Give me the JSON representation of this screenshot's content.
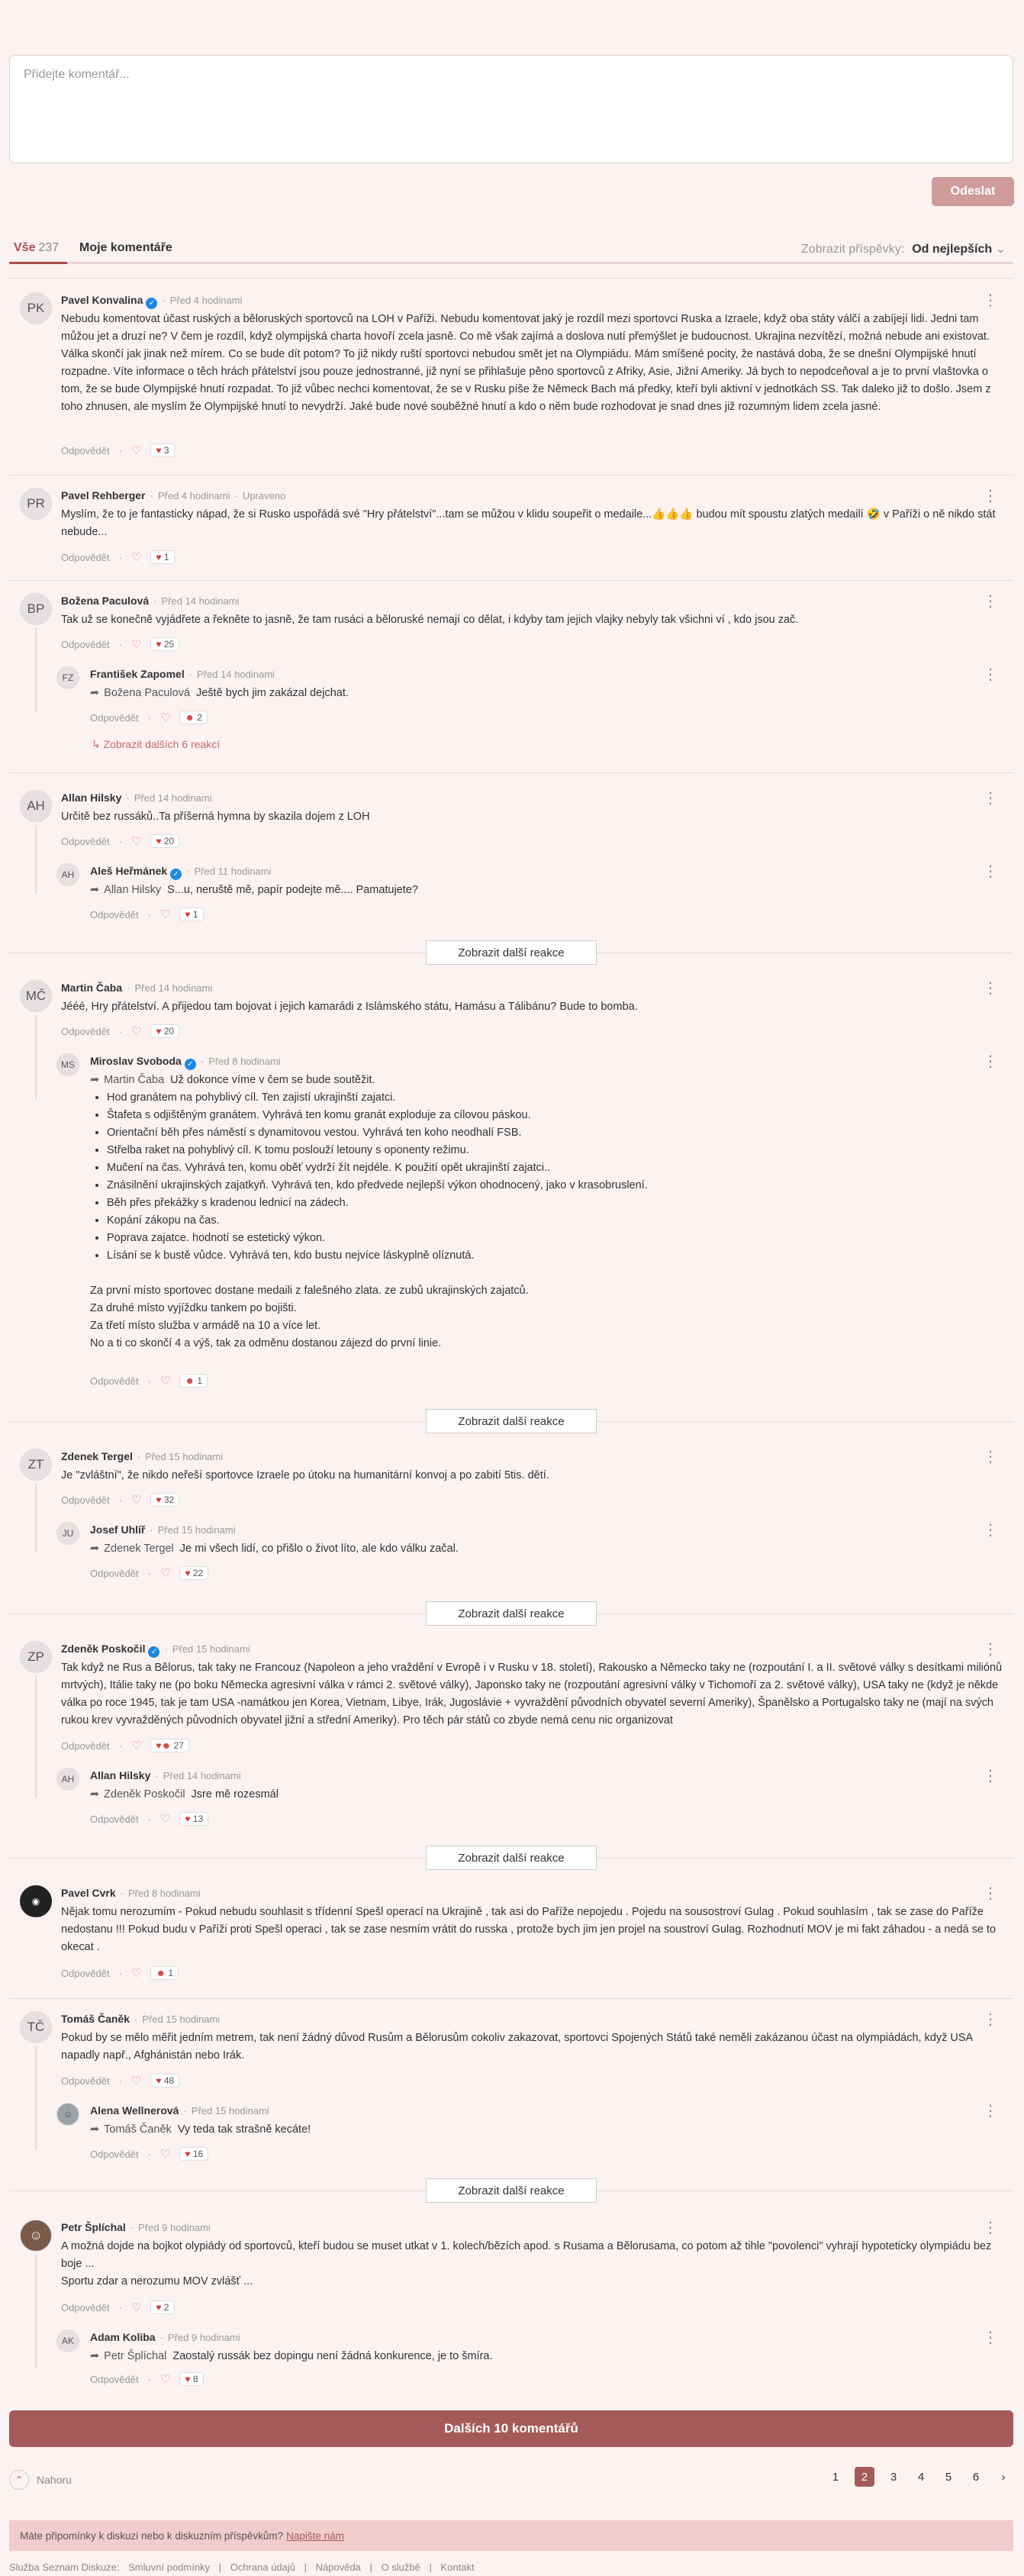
{
  "composer": {
    "placeholder": "Přidejte komentář..."
  },
  "send_label": "Odeslat",
  "tabs": {
    "all_label": "Vše",
    "all_count": "237",
    "mine_label": "Moje komentáře"
  },
  "sort": {
    "label": "Zobrazit příspěvky:",
    "value": "Od nejlepších"
  },
  "reply_label": "Odpovědět",
  "more_reactions": "Zobrazit další reakce",
  "more_comments": "Dalších 10 komentářů",
  "top_label": "Nahoru",
  "pages": [
    "1",
    "2",
    "3",
    "4",
    "5",
    "6"
  ],
  "notice": {
    "text": "Máte připomínky k diskuzi nebo k diskuzním příspěvkům?",
    "link": "Napište nám"
  },
  "footer": [
    "Služba Seznam Diskuze:",
    "Smluvní podmínky",
    "|",
    "Ochrana údajů",
    "|",
    "Nápověda",
    "|",
    "O službě",
    "|",
    "Kontakt"
  ],
  "comments": {
    "c1": {
      "initials": "PK",
      "name": "Pavel Konvalina",
      "time": "Před 4 hodinami",
      "text": "Nebudu komentovat účast ruských a běloruských sportovců na LOH v Paříži. Nebudu komentovat jaký je rozdíl mezi sportovci Ruska a Izraele, když oba státy válčí a zabíjejí lidi. Jedni tam můžou jet a druzí ne? V čem je rozdíl, když olympijská charta hovoří zcela jasně. Co mě však zajímá a doslova nutí přemýšlet je budoucnost. Ukrajina nezvítězí, možná nebude ani existovat. Válka skončí jak jinak než mírem. Co se bude dít potom? To již nikdy ruští sportovci nebudou smět jet na Olympiádu. Mám smíšené pocity, že nastává doba, že se dnešní Olympijské hnutí rozpadne. Víte informace o těch hrách přátelství jsou pouze jednostranné, již nyní se přihlašuje pěno sportovců z Afriky, Asie, Jižní Ameriky. Já bych to nepodceňoval a je to první vlaštovka o tom, že se bude Olympijské hnutí rozpadat. To již vůbec nechci komentovat, že se v Rusku píše že Německ Bach má předky, kteří byli aktivní v jednotkách SS. Tak daleko již to došlo. Jsem z toho zhnusen, ale myslím že Olympijské hnutí to nevydrží. Jaké bude nové souběžné hnutí a kdo o něm bude rozhodovat je snad dnes již rozumným lidem zcela jasné.",
      "reactions": "3"
    },
    "c2": {
      "initials": "PR",
      "name": "Pavel Rehberger",
      "time": "Před 4 hodinami",
      "edited": "Upraveno",
      "text": "Myslím, že to je fantasticky nápad, že si Rusko uspořádá své \"Hry přátelství\"...tam se můžou v klidu soupeřit o medaile...👍👍👍 budou mít spoustu zlatých medailí 🤣 v Paříži o ně nikdo stát nebude...",
      "reactions": "1"
    },
    "c3": {
      "initials": "BP",
      "name": "Božena Paculová",
      "time": "Před 14 hodinami",
      "text": "Tak už se konečně vyjádřete a řekněte to jasně, že tam rusáci a běloruské nemají co dělat, i kdyby tam jejich vlajky nebyly tak všichni ví , kdo jsou zač.",
      "reactions": "25"
    },
    "c3r": {
      "initials": "FZ",
      "name": "František Zapomel",
      "time": "Před 14 hodinami",
      "quote": "Božena Paculová",
      "text": "Ještě bych jim zakázal dejchat.",
      "reactions": "2",
      "more": "Zobrazit dalších 6 reakcí"
    },
    "c4": {
      "initials": "AH",
      "name": "Allan Hilsky",
      "time": "Před 14 hodinami",
      "text": "Určitě bez russáků..Ta příšerná hymna by skazila dojem z LOH",
      "reactions": "20"
    },
    "c4r": {
      "initials": "AH",
      "name": "Aleš Heřmánek",
      "time": "Před 11 hodinami",
      "quote": "Allan Hilsky",
      "text": "S...u, neruště mě, papír podejte mě.... Pamatujete?",
      "reactions": "1"
    },
    "c5": {
      "initials": "MČ",
      "name": "Martin Čaba",
      "time": "Před 14 hodinami",
      "text": "Jééé, Hry přátelství. A přijedou tam bojovat i jejich kamarádi z Islámského státu, Hamásu a Tálibánu? Bude to bomba.",
      "reactions": "20"
    },
    "c5r": {
      "initials": "MS",
      "name": "Miroslav Svoboda",
      "time": "Před 8 hodinami",
      "quote": "Martin Čaba",
      "quote_text": "Už dokonce víme v čem se bude soutěžit.",
      "items": [
        "Hod granátem na pohyblivý cíl. Ten zajistí ukrajinští zajatci.",
        "Štafeta s odjištěným granátem. Vyhrává ten komu granát exploduje za cílovou páskou.",
        "Orientační běh přes náměstí s dynamitovou vestou. Vyhrává ten koho neodhalí FSB.",
        "Střelba raket na pohyblivý cíl. K tomu poslouží letouny s oponenty režimu.",
        "Mučení na čas. Vyhrává ten, komu oběť vydrží žít nejdéle. K použití opět ukrajinští zajatci..",
        "Znásilnění ukrajinských zajatkyň. Vyhrává ten, kdo předvede nejlepší výkon ohodnocený, jako v krasobruslení.",
        "Běh přes překážky s kradenou lednicí na zádech.",
        "Kopání zákopu na čas.",
        "Poprava zajatce. hodnotí se estetický výkon.",
        "Lísání se k bustě vůdce. Vyhrává ten, kdo bustu nejvíce láskyplně olíznutá."
      ],
      "closing": [
        "Za první místo sportovec dostane medaili z falešného zlata. ze zubů ukrajinských zajatců.",
        "Za druhé místo vyjíždku tankem po bojišti.",
        "Za třetí místo služba v armádě na 10 a více let.",
        "No a ti co skončí 4 a výš, tak za odměnu dostanou zájezd do první linie."
      ],
      "reactions": "1"
    },
    "c6": {
      "initials": "ZT",
      "name": "Zdenek Tergel",
      "time": "Před 15 hodinami",
      "text": "Je \"zvláštní\", že nikdo neřeší sportovce Izraele po útoku na humanitární konvoj a po zabití 5tis. dětí.",
      "reactions": "32"
    },
    "c6r": {
      "initials": "JU",
      "name": "Josef Uhlíř",
      "time": "Před 15 hodinami",
      "quote": "Zdenek Tergel",
      "text": "Je mi všech lidí, co přišlo o život líto, ale kdo válku začal.",
      "reactions": "22"
    },
    "c7": {
      "initials": "ZP",
      "name": "Zdeněk Poskočil",
      "time": "Před 15 hodinami",
      "text": "Tak když ne Rus a Bělorus, tak taky ne Francouz (Napoleon a jeho vraždění v Evropě i v Rusku v 18. století), Rakousko a Německo taky ne (rozpoutání I. a II. světové války s desítkami miliónů mrtvých), Itálie taky ne (po boku Německa agresivní válka v rámci 2. světové války), Japonsko taky ne (rozpoutání agresivní války v Tichomoří za 2. světové války), USA taky ne (když je někde válka po roce 1945, tak je tam USA -namátkou jen Korea, Vietnam, Libye, Irák, Jugoslávie + vyvraždění původních obyvatel severní Ameriky), Španělsko a Portugalsko taky ne (mají na svých rukou krev vyvražděných původních obyvatel jižní a střední Ameriky). Pro těch pár států co zbyde nemá cenu nic organizovat",
      "reactions": "27"
    },
    "c7r": {
      "initials": "AH",
      "name": "Allan Hilsky",
      "time": "Před 14 hodinami",
      "quote": "Zdeněk Poskočil",
      "text": "Jsre mě rozesmál",
      "reactions": "13"
    },
    "c8": {
      "name": "Pavel Cvrk",
      "time": "Před 8 hodinami",
      "text": "Nějak tomu nerozumím - Pokud nebudu souhlasit s třídenní Spešl operací na Ukrajině , tak asi do Paříže nepojedu . Pojedu na sousostroví Gulag . Pokud souhlasím , tak se zase do Paříže nedostanu !!! Pokud budu v Paříži proti Spešl operaci , tak se zase nesmím vrátit do russka , protože bych jim jen projel na soustroví Gulag. Rozhodnutí MOV je mi fakt záhadou - a nedá se to okecat .",
      "reactions": "1"
    },
    "c9": {
      "initials": "TČ",
      "name": "Tomáš Čaněk",
      "time": "Před 15 hodinami",
      "text": "Pokud by se mělo měřit jedním metrem, tak není žádný důvod Rusům a Bělorusům cokoliv zakazovat, sportovci Spojených Států také neměli zakázanou účast na olympiádách, když USA napadly např., Afghánistán nebo Irák.",
      "reactions": "48"
    },
    "c9r": {
      "name": "Alena Wellnerová",
      "time": "Před 15 hodinami",
      "quote": "Tomáš Čaněk",
      "text": "Vy teda tak strašně kecáte!",
      "reactions": "16"
    },
    "c10": {
      "name": "Petr Šplíchal",
      "time": "Před 9 hodinami",
      "text": "A možná dojde na bojkot olypiády od sportovců, kteří budou se muset utkat v 1. kolech/bězích apod. s Rusama a Bělorusama, co potom až tihle \"povolenci\" vyhrají hypoteticky olympiádu bez boje ...",
      "text2": "Sportu zdar a nerozumu MOV zvlášť ...",
      "reactions": "2"
    },
    "c10r": {
      "initials": "AK",
      "name": "Adam Koliba",
      "time": "Před 9 hodinami",
      "quote": "Petr Šplíchal",
      "text": "Zaostalý russák bez dopingu není žádná konkurence, je to šmíra.",
      "reactions": "8"
    }
  }
}
